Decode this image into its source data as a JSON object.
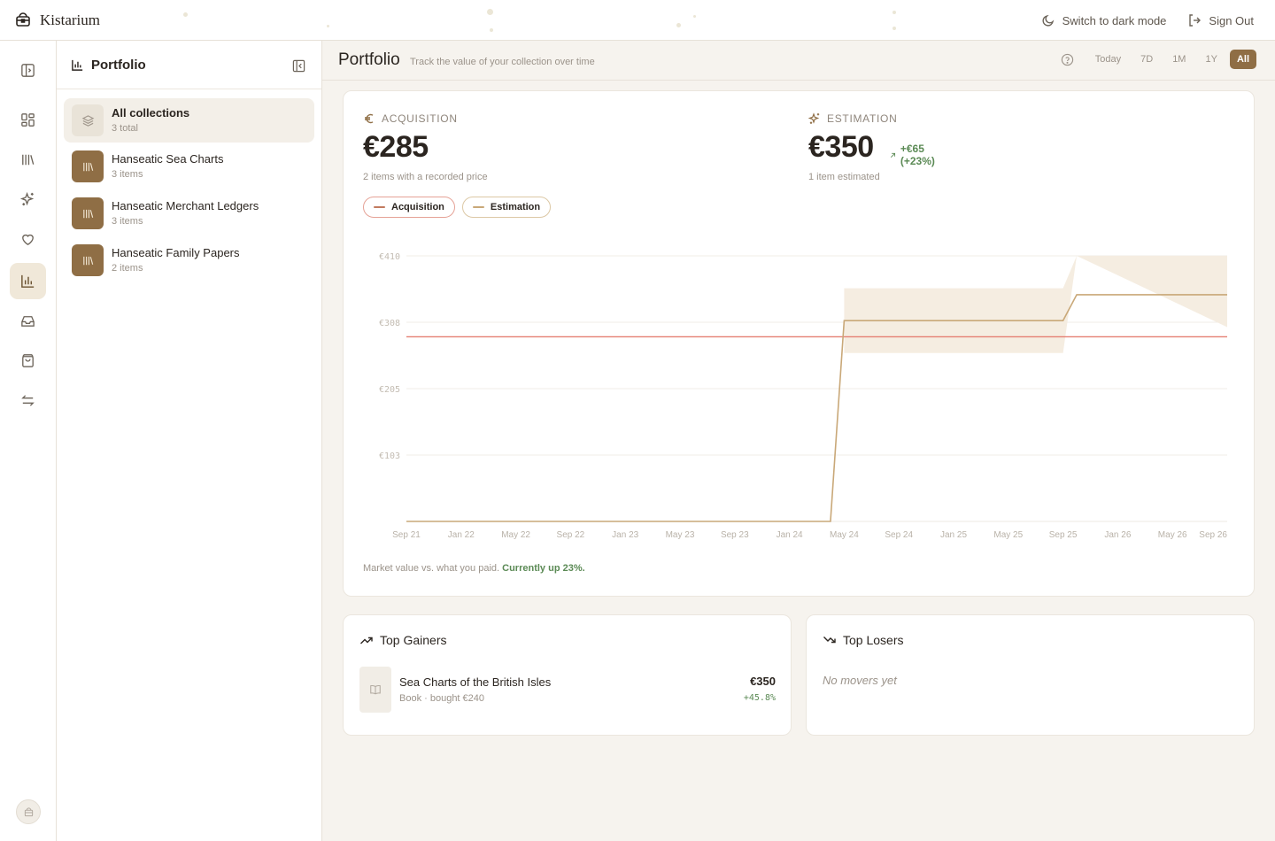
{
  "app": {
    "name": "Kistarium"
  },
  "topbar": {
    "dark_mode_label": "Switch to dark mode",
    "sign_out_label": "Sign Out"
  },
  "rail": {
    "items": [
      "panel-toggle-icon",
      "dashboard-icon",
      "library-icon",
      "sparkle-icon",
      "heart-icon",
      "chart-icon",
      "inbox-icon",
      "bag-icon",
      "transfer-icon"
    ],
    "active": "chart-icon"
  },
  "panel": {
    "title": "Portfolio",
    "collections": [
      {
        "name": "All collections",
        "count": "3 total"
      },
      {
        "name": "Hanseatic Sea Charts",
        "count": "3 items"
      },
      {
        "name": "Hanseatic Merchant Ledgers",
        "count": "3 items"
      },
      {
        "name": "Hanseatic Family Papers",
        "count": "2 items"
      }
    ]
  },
  "main": {
    "title": "Portfolio",
    "subtitle": "Track the value of your collection over time",
    "ranges": [
      "Today",
      "7D",
      "1M",
      "1Y",
      "All"
    ],
    "active_range": "All"
  },
  "metrics": {
    "acquisition": {
      "label": "ACQUISITION",
      "value": "€285",
      "note": "2 items with a recorded price"
    },
    "estimation": {
      "label": "ESTIMATION",
      "value": "€350",
      "delta": "+€65 (+23%)",
      "note": "1 item estimated"
    }
  },
  "legend": {
    "acquisition": "Acquisition",
    "estimation": "Estimation"
  },
  "footnote": {
    "text": "Market value vs. what you paid.",
    "highlight": "Currently up 23%."
  },
  "colors": {
    "accent": "#8f6e45",
    "acquisition_line": "#e57f72",
    "estimation_line": "#c9a878",
    "estimation_band": "#f5ede1",
    "positive": "#5b8a55"
  },
  "chart_data": {
    "type": "line",
    "y_tick_labels": [
      "€410",
      "€308",
      "€205",
      "€103"
    ],
    "ylim": [
      0,
      410
    ],
    "x_tick_labels": [
      "Sep 21",
      "Jan 22",
      "May 22",
      "Sep 22",
      "Jan 23",
      "May 23",
      "Sep 23",
      "Jan 24",
      "May 24",
      "Sep 24",
      "Jan 25",
      "May 25",
      "Sep 25",
      "Jan 26",
      "May 26",
      "Sep 26"
    ],
    "xlim": [
      "2021-09",
      "2026-09"
    ],
    "grid": true,
    "series": [
      {
        "name": "Acquisition",
        "points": [
          [
            "2021-09",
            285
          ],
          [
            "2026-09",
            285
          ]
        ]
      },
      {
        "name": "Estimation",
        "points": [
          [
            "2021-09",
            0
          ],
          [
            "2024-04",
            0
          ],
          [
            "2024-05",
            310
          ],
          [
            "2025-09",
            310
          ],
          [
            "2025-10",
            350
          ],
          [
            "2026-09",
            350
          ]
        ],
        "band": [
          [
            "2024-05",
            260,
            360
          ],
          [
            "2025-09",
            260,
            360
          ],
          [
            "2025-10",
            410,
            410
          ],
          [
            "2026-09",
            300,
            410
          ]
        ]
      }
    ]
  },
  "gainers": {
    "title": "Top Gainers",
    "items": [
      {
        "name": "Sea Charts of the British Isles",
        "meta": "Book · bought €240",
        "price": "€350",
        "pct": "+45.8%"
      }
    ]
  },
  "losers": {
    "title": "Top Losers",
    "empty": "No movers yet"
  }
}
